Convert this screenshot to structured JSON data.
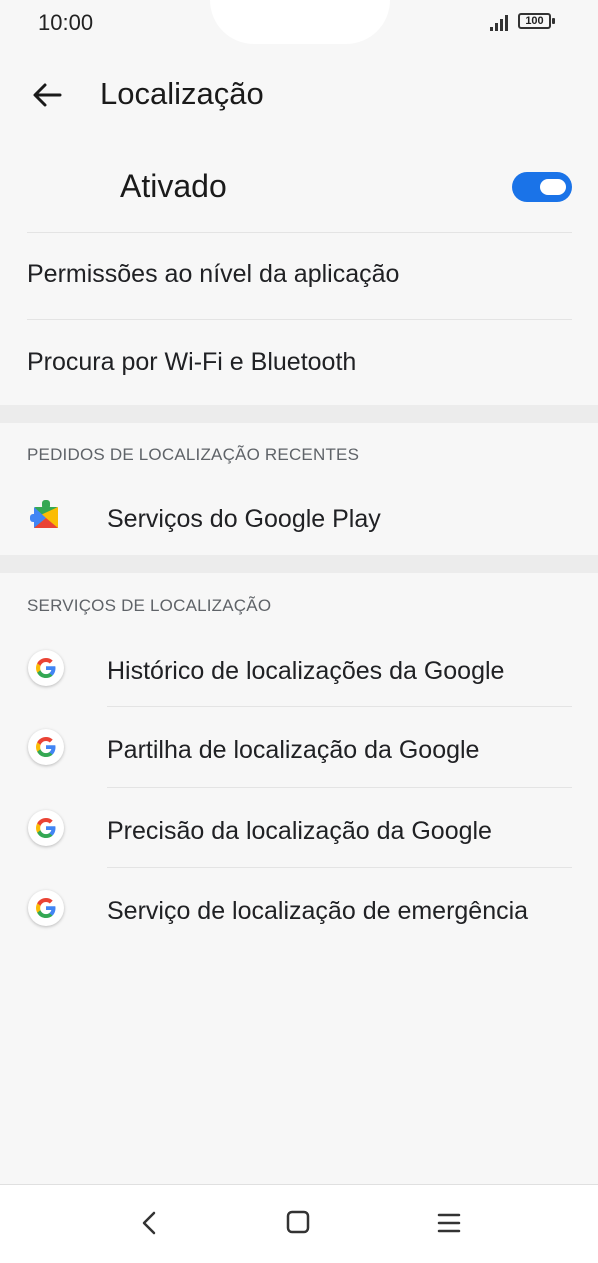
{
  "status_bar": {
    "time": "10:00",
    "battery": "100"
  },
  "header": {
    "title": "Localização"
  },
  "master_toggle": {
    "label": "Ativado",
    "state": "on",
    "accent_color": "#1a73e8"
  },
  "settings": [
    {
      "label": "Permissões ao nível da aplicação"
    },
    {
      "label": "Procura por Wi-Fi e Bluetooth"
    }
  ],
  "recent_requests": {
    "header": "PEDIDOS DE LOCALIZAÇÃO RECENTES",
    "items": [
      {
        "label": "Serviços do Google Play",
        "icon": "google-play-services-icon"
      }
    ]
  },
  "location_services": {
    "header": "SERVIÇOS DE LOCALIZAÇÃO",
    "items": [
      {
        "label": "Histórico de localizações da Google",
        "icon": "google-g-icon"
      },
      {
        "label": "Partilha de localização da Google",
        "icon": "google-g-icon"
      },
      {
        "label": "Precisão da localização da Google",
        "icon": "google-g-icon"
      },
      {
        "label": "Serviço de localização de emergência",
        "icon": "google-g-icon"
      }
    ]
  },
  "nav_bar": {
    "icons": [
      "back-icon",
      "home-icon",
      "menu-icon"
    ]
  }
}
